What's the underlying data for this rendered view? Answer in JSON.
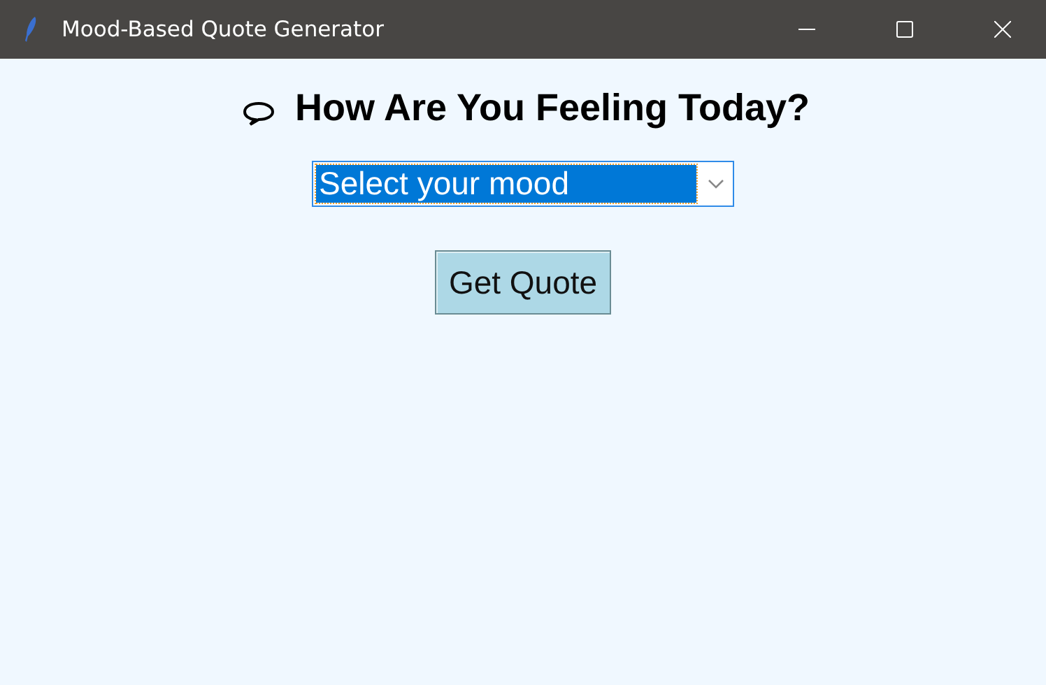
{
  "window": {
    "title": "Mood-Based Quote Generator"
  },
  "heading": "How Are You Feeling Today?",
  "mood_dropdown": {
    "value": "Select your mood",
    "focused": true
  },
  "buttons": [
    "Get Quote"
  ]
}
